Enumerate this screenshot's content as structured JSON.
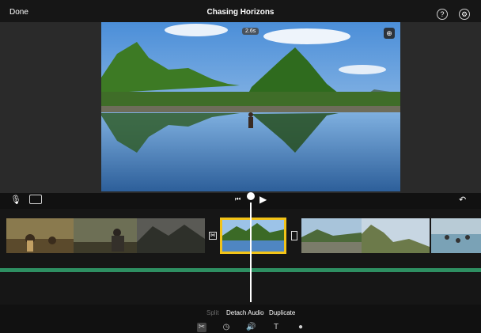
{
  "header": {
    "done_label": "Done",
    "project_title": "Chasing Horizons",
    "help_icon": "?",
    "settings_icon": "⚙"
  },
  "preview": {
    "time_badge": "2.6s",
    "zoom_icon": "⊕"
  },
  "transport": {
    "mic_icon": "🎙",
    "skip_back_icon": "⏮",
    "play_icon": "▶",
    "undo_icon": "↶"
  },
  "timeline": {
    "transition_icon": "⋈",
    "clips": [
      {
        "name": "clip-hikers-forest"
      },
      {
        "name": "clip-hiker-backpack"
      },
      {
        "name": "clip-misty-mountains"
      },
      {
        "name": "clip-river-selected",
        "selected": true
      },
      {
        "name": "clip-lake-hills"
      },
      {
        "name": "clip-cliffs-coast"
      },
      {
        "name": "clip-beach-crowd"
      }
    ]
  },
  "edit_menu": {
    "split": "Split",
    "detach_audio": "Detach Audio",
    "duplicate": "Duplicate"
  },
  "tools": {
    "scissors": "✂",
    "speed": "◷",
    "volume": "🔊",
    "titles": "T",
    "filters": "●"
  },
  "colors": {
    "selection": "#f2c318",
    "audio_track": "#2e8f62"
  }
}
